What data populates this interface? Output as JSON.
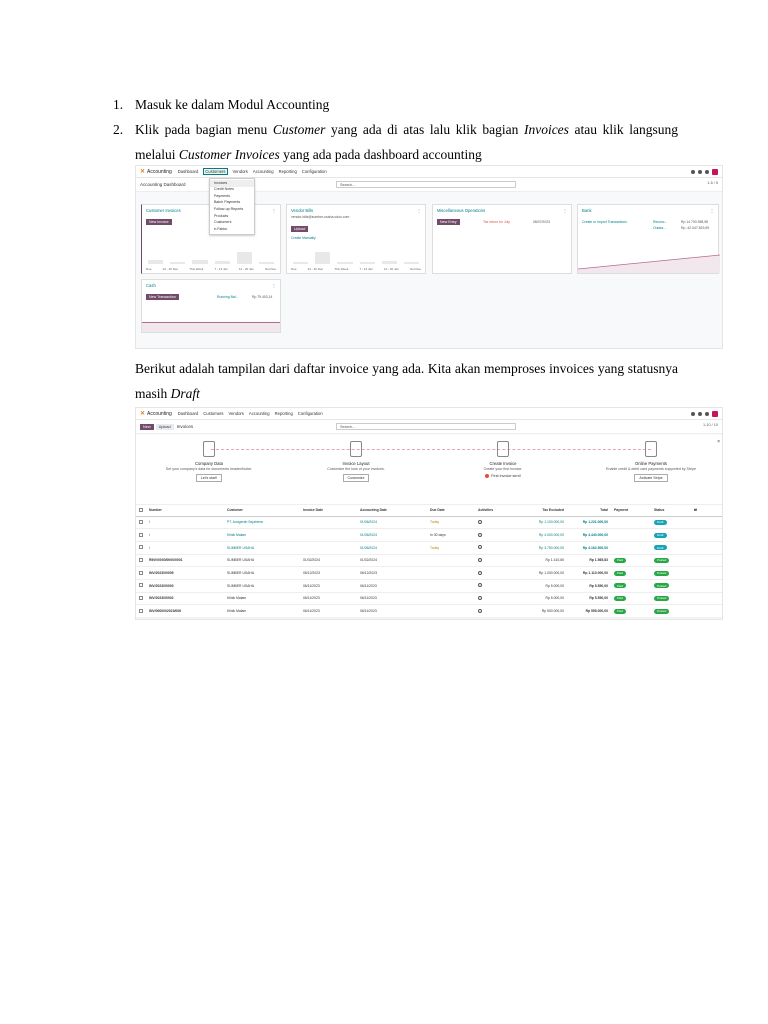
{
  "steps": [
    {
      "num": "1.",
      "text": "Masuk ke dalam Modul Accounting"
    },
    {
      "num": "2.",
      "pre": "Klik pada bagian menu ",
      "em1": "Customer",
      "mid1": " yang ada di atas lalu klik bagian ",
      "em2": "Invoices",
      "mid2": " atau klik langsung melalui ",
      "em3": "Customer Invoices",
      "post": " yang ada pada dashboard accounting"
    }
  ],
  "paragraph": {
    "pre": "Berikut adalah tampilan dari daftar invoice yang ada. Kita akan memproses invoices yang statusnya masih ",
    "em": "Draft"
  },
  "shot1": {
    "app": "Accounting",
    "menus": [
      "Dashboard",
      "Customers",
      "Vendors",
      "Accounting",
      "Reporting",
      "Configuration"
    ],
    "title": "Accounting Dashboard",
    "search_placeholder": "Search...",
    "pager": "1-5 / 5",
    "dropdown": [
      "Invoices",
      "Credit Notes",
      "Payments",
      "Batch Payments",
      "Follow-up Reports",
      "Products",
      "Customers",
      "e-Faktur"
    ],
    "cards": {
      "customer_invoices": {
        "title": "Customer Invoices",
        "button": "New Invoice"
      },
      "vendor_bills": {
        "title": "Vendor Bills",
        "email": "vendor-bills@sumber-usaha.odoo.com",
        "button": "Upload",
        "link": "Create Manually"
      },
      "misc": {
        "title": "Miscellaneous Operations",
        "button": "New Entry",
        "note": "Tax return for July",
        "date": "08/07/2023"
      },
      "bank": {
        "title": "Bank",
        "link": "Create or Import Transactions",
        "rows": [
          {
            "label": "Reconc...",
            "value": "Rp 14.700.958,98"
          },
          {
            "label": "Outsta...",
            "value": "Rp -42.047.819,69"
          }
        ]
      },
      "cash": {
        "title": "Cash",
        "button": "New Transaction",
        "label": "Running Bal...",
        "value": "Rp 79.403,14"
      }
    },
    "x_labels": [
      "Due",
      "24 - 30 Dec",
      "This Week",
      "7 - 13 Jan",
      "14 - 20 Jan",
      "Not Due"
    ]
  },
  "shot2": {
    "app": "Accounting",
    "menus": [
      "Dashboard",
      "Customers",
      "Vendors",
      "Accounting",
      "Reporting",
      "Configuration"
    ],
    "new_label": "New",
    "upload_label": "Upload",
    "title": "Invoices",
    "search_placeholder": "Search...",
    "pager": "1-10 / 10",
    "onboarding": [
      {
        "title": "Company Data",
        "desc": "Set your company's data for documents header/footer.",
        "action": "Let's start!"
      },
      {
        "title": "Invoice Layout",
        "desc": "Customize the look of your invoices.",
        "action": "Customize"
      },
      {
        "title": "Create Invoice",
        "desc": "Create your first invoice.",
        "action": "First invoice sent!"
      },
      {
        "title": "Online Payments",
        "desc": "Enable credit & debit card payments supported by Stripe",
        "action": "Activate Stripe"
      }
    ],
    "columns": [
      "Number",
      "Customer",
      "Invoice Date",
      "Accounting Date",
      "Due Date",
      "Activities",
      "Tax Excluded",
      "Total",
      "Payment",
      "Status"
    ],
    "rows": [
      {
        "number": "/",
        "customer": "PT. Anugerah Sejahtera",
        "invoice_date": "",
        "accounting_date": "01/06/2024",
        "due_date": "Today",
        "tax_excluded": "Rp 1.100.000,00",
        "total": "Rp 1.221.000,00",
        "payment": "",
        "status": "Draft"
      },
      {
        "number": "/",
        "customer": "Klinik Malam",
        "invoice_date": "",
        "accounting_date": "01/06/2024",
        "due_date": "In 30 days",
        "tax_excluded": "Rp 4.000.000,00",
        "total": "Rp 4.440.000,00",
        "payment": "",
        "status": "Draft"
      },
      {
        "number": "/",
        "customer": "SUMBER USAHA",
        "invoice_date": "",
        "accounting_date": "01/06/2024",
        "due_date": "Today",
        "tax_excluded": "Rp 3.750.000,00",
        "total": "Rp 4.162.500,00",
        "payment": "",
        "status": "Draft"
      },
      {
        "number": "RINV/0000/0000/0001",
        "customer": "SUMBER USAHA",
        "invoice_date": "01/02/2024",
        "accounting_date": "01/02/2024",
        "due_date": "",
        "tax_excluded": "Rp 1.410,60",
        "total": "Rp 1.565,83",
        "payment": "Paid",
        "status": "Posted"
      },
      {
        "number": "INV/2023/00005",
        "customer": "SUMBER USAHA",
        "invoice_date": "06/12/2023",
        "accounting_date": "06/12/2023",
        "due_date": "",
        "tax_excluded": "Rp 1.000.000,00",
        "total": "Rp 1.110.000,00",
        "payment": "Paid",
        "status": "Posted"
      },
      {
        "number": "INV/2023/00003",
        "customer": "SUMBER USAHA",
        "invoice_date": "06/11/2023",
        "accounting_date": "06/11/2023",
        "due_date": "",
        "tax_excluded": "Rp 5.000,00",
        "total": "Rp 5.550,00",
        "payment": "Paid",
        "status": "Posted"
      },
      {
        "number": "INV/2023/00002",
        "customer": "Klinik Malam",
        "invoice_date": "06/11/2023",
        "accounting_date": "06/11/2023",
        "due_date": "",
        "tax_excluded": "Rp 5.000,00",
        "total": "Rp 5.550,00",
        "payment": "Paid",
        "status": "Posted"
      },
      {
        "number": "INV/0000/0/2023/006",
        "customer": "Klinik Malam",
        "invoice_date": "06/11/2023",
        "accounting_date": "06/11/2023",
        "due_date": "",
        "tax_excluded": "Rp 500.000,00",
        "total": "Rp 555.000,00",
        "payment": "Paid",
        "status": "Posted"
      }
    ]
  }
}
